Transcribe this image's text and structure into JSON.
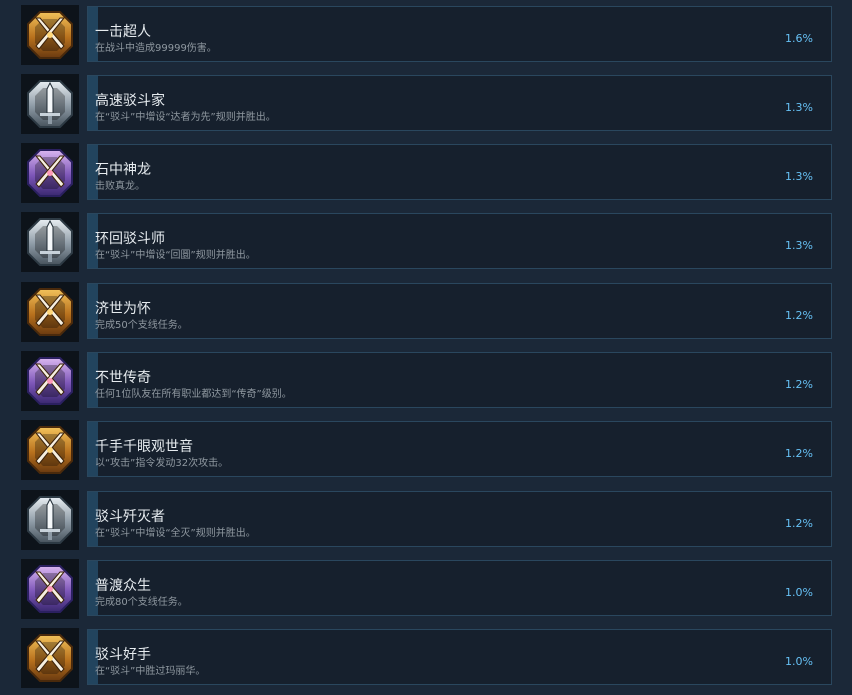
{
  "achievements": [
    {
      "title": "一击超人",
      "desc": "在战斗中造成99999伤害。",
      "pct": "1.6%",
      "progress": 0.016,
      "badge": "gold-swords-badge-icon"
    },
    {
      "title": "高速驳斗家",
      "desc": "在“驳斗”中增设“达者为先”规则并胜出。",
      "pct": "1.3%",
      "progress": 0.013,
      "badge": "silver-sword-badge-icon"
    },
    {
      "title": "石中神龙",
      "desc": "击败真龙。",
      "pct": "1.3%",
      "progress": 0.013,
      "badge": "platinum-swords-badge-icon"
    },
    {
      "title": "环回驳斗师",
      "desc": "在“驳斗”中增设“回圜”规则并胜出。",
      "pct": "1.3%",
      "progress": 0.013,
      "badge": "silver-sword-badge-icon"
    },
    {
      "title": "济世为怀",
      "desc": "完成50个支线任务。",
      "pct": "1.2%",
      "progress": 0.012,
      "badge": "gold-swords-badge-icon"
    },
    {
      "title": "不世传奇",
      "desc": "任何1位队友在所有职业都达到“传奇”级别。",
      "pct": "1.2%",
      "progress": 0.012,
      "badge": "platinum-swords-badge-icon"
    },
    {
      "title": "千手千眼观世音",
      "desc": "以“攻击”指令发动32次攻击。",
      "pct": "1.2%",
      "progress": 0.012,
      "badge": "gold-swords-badge-icon"
    },
    {
      "title": "驳斗歼灭者",
      "desc": "在“驳斗”中增设“全灭”规则并胜出。",
      "pct": "1.2%",
      "progress": 0.012,
      "badge": "silver-sword-badge-icon"
    },
    {
      "title": "普渡众生",
      "desc": "完成80个支线任务。",
      "pct": "1.0%",
      "progress": 0.01,
      "badge": "platinum-swords-badge-icon"
    },
    {
      "title": "驳斗好手",
      "desc": "在“驳斗”中胜过玛丽华。",
      "pct": "1.0%",
      "progress": 0.01,
      "badge": "gold-swords-badge-icon"
    }
  ],
  "colors": {
    "background": "#1b2838",
    "panel": "#16202d",
    "border": "#2a475e",
    "progress": "#22445e",
    "percent": "#66c0f4",
    "title": "#e6ebef",
    "desc": "#8f98a0"
  }
}
